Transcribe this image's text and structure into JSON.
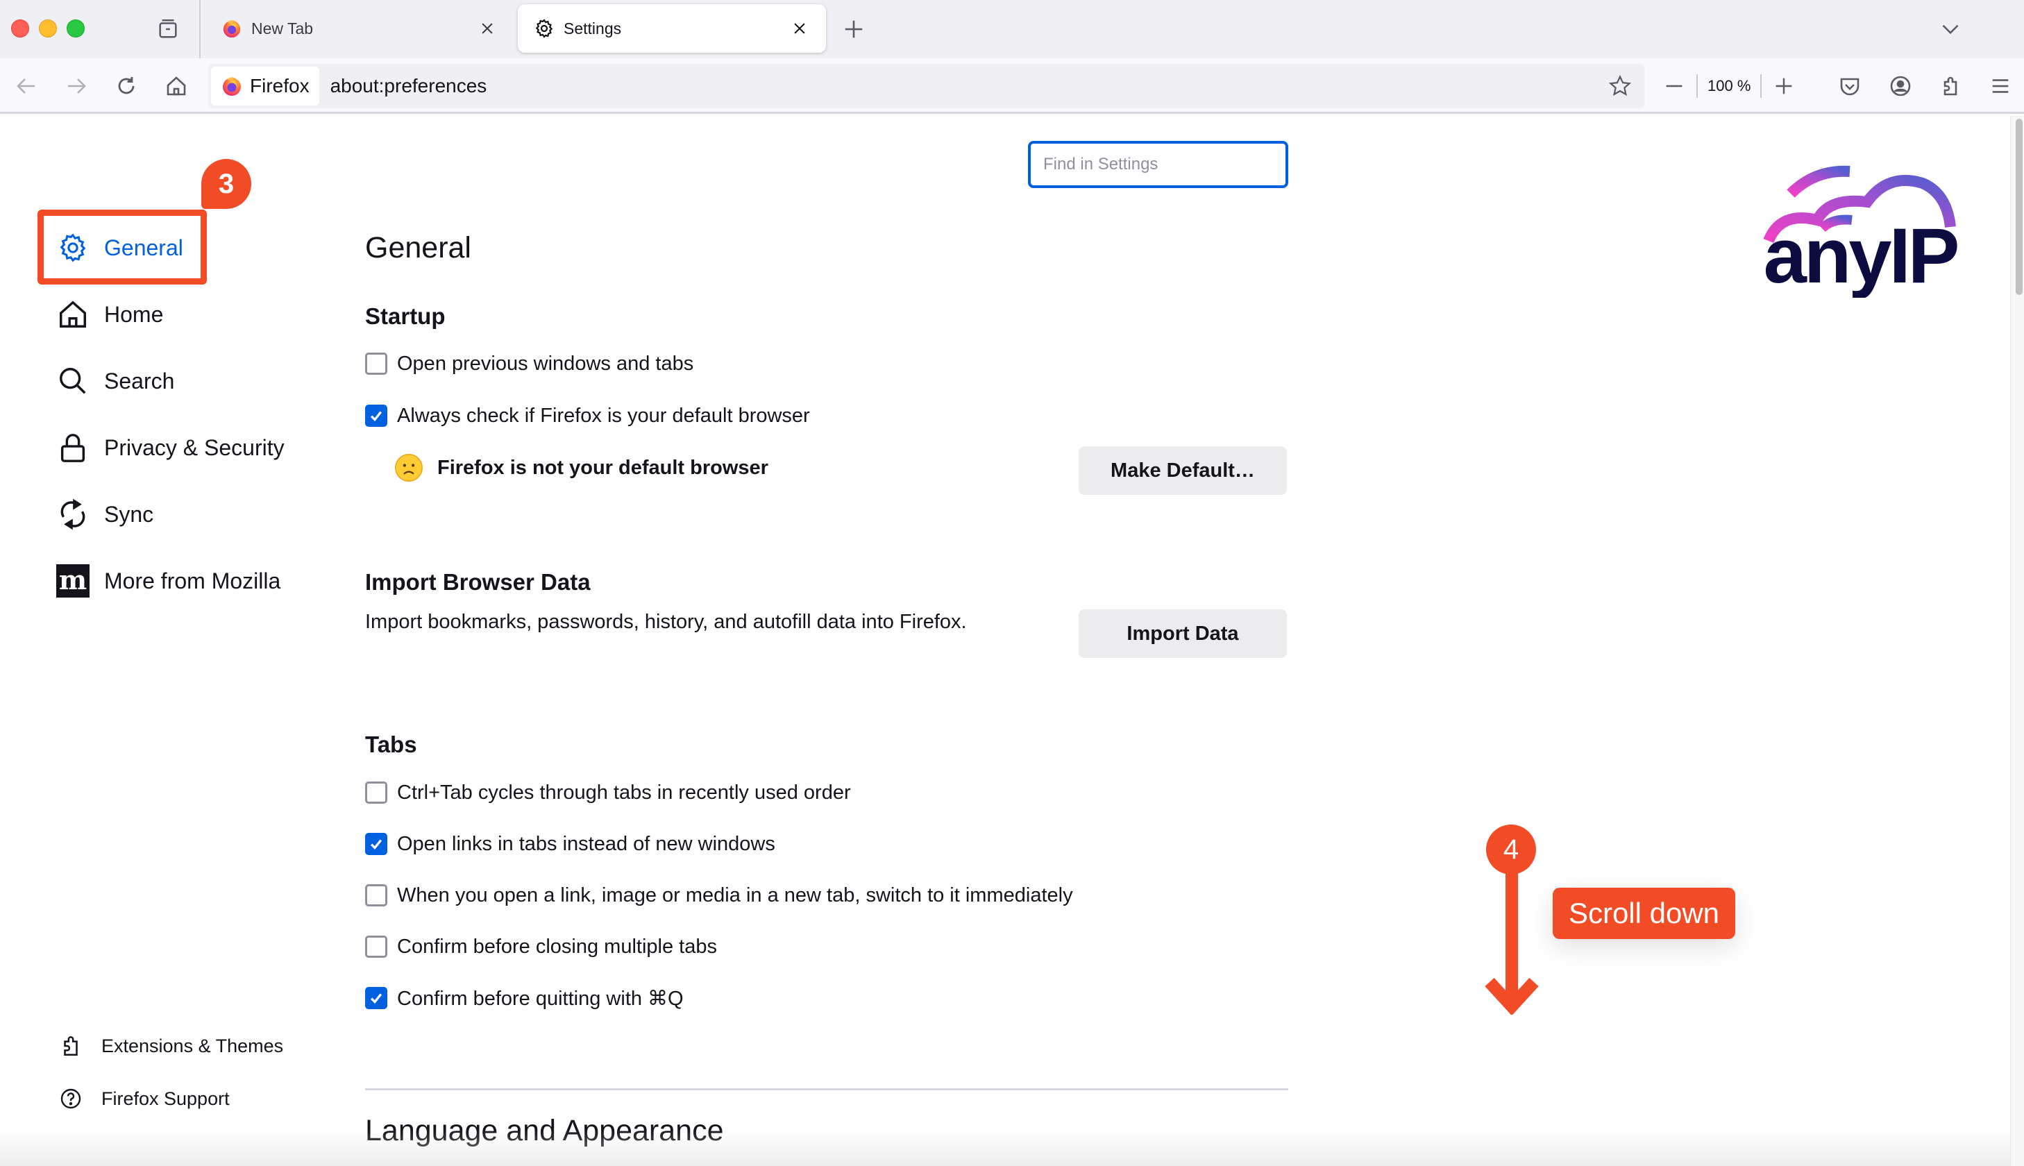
{
  "window": {
    "traffic_lights": [
      "close",
      "minimize",
      "zoom"
    ]
  },
  "tabs": [
    {
      "label": "New Tab",
      "icon": "firefox-icon",
      "active": false
    },
    {
      "label": "Settings",
      "icon": "gear-icon",
      "active": true
    }
  ],
  "navbar": {
    "identity_label": "Firefox",
    "url": "about:preferences",
    "zoom_level": "100 %"
  },
  "search": {
    "placeholder": "Find in Settings",
    "value": ""
  },
  "sidebar": {
    "items": [
      {
        "label": "General",
        "icon": "gear-icon",
        "selected": true
      },
      {
        "label": "Home",
        "icon": "home-icon",
        "selected": false
      },
      {
        "label": "Search",
        "icon": "search-icon",
        "selected": false
      },
      {
        "label": "Privacy & Security",
        "icon": "lock-icon",
        "selected": false
      },
      {
        "label": "Sync",
        "icon": "sync-icon",
        "selected": false
      },
      {
        "label": "More from Mozilla",
        "icon": "mozilla-m-icon",
        "selected": false
      }
    ],
    "footer": [
      {
        "label": "Extensions & Themes",
        "icon": "puzzle-icon"
      },
      {
        "label": "Firefox Support",
        "icon": "help-icon"
      }
    ]
  },
  "main": {
    "title": "General",
    "startup": {
      "heading": "Startup",
      "options": [
        {
          "label": "Open previous windows and tabs",
          "checked": false
        },
        {
          "label": "Always check if Firefox is your default browser",
          "checked": true
        }
      ],
      "default_status": "Firefox is not your default browser",
      "make_default_label": "Make Default…"
    },
    "import": {
      "heading": "Import Browser Data",
      "description": "Import bookmarks, passwords, history, and autofill data into Firefox.",
      "button_label": "Import Data"
    },
    "tabs_section": {
      "heading": "Tabs",
      "options": [
        {
          "label": "Ctrl+Tab cycles through tabs in recently used order",
          "checked": false
        },
        {
          "label": "Open links in tabs instead of new windows",
          "checked": true
        },
        {
          "label": "When you open a link, image or media in a new tab, switch to it immediately",
          "checked": false
        },
        {
          "label": "Confirm before closing multiple tabs",
          "checked": false
        },
        {
          "label": "Confirm before quitting with ⌘Q",
          "checked": true
        }
      ]
    },
    "next_section_title": "Language and Appearance"
  },
  "branding": {
    "logo_text": "anyIP"
  },
  "annotations": {
    "step3": {
      "number": "3"
    },
    "step4": {
      "number": "4",
      "callout": "Scroll down"
    },
    "color": "#f24c27"
  },
  "colors": {
    "accent": "#0061e0",
    "annotation": "#f24c27"
  }
}
